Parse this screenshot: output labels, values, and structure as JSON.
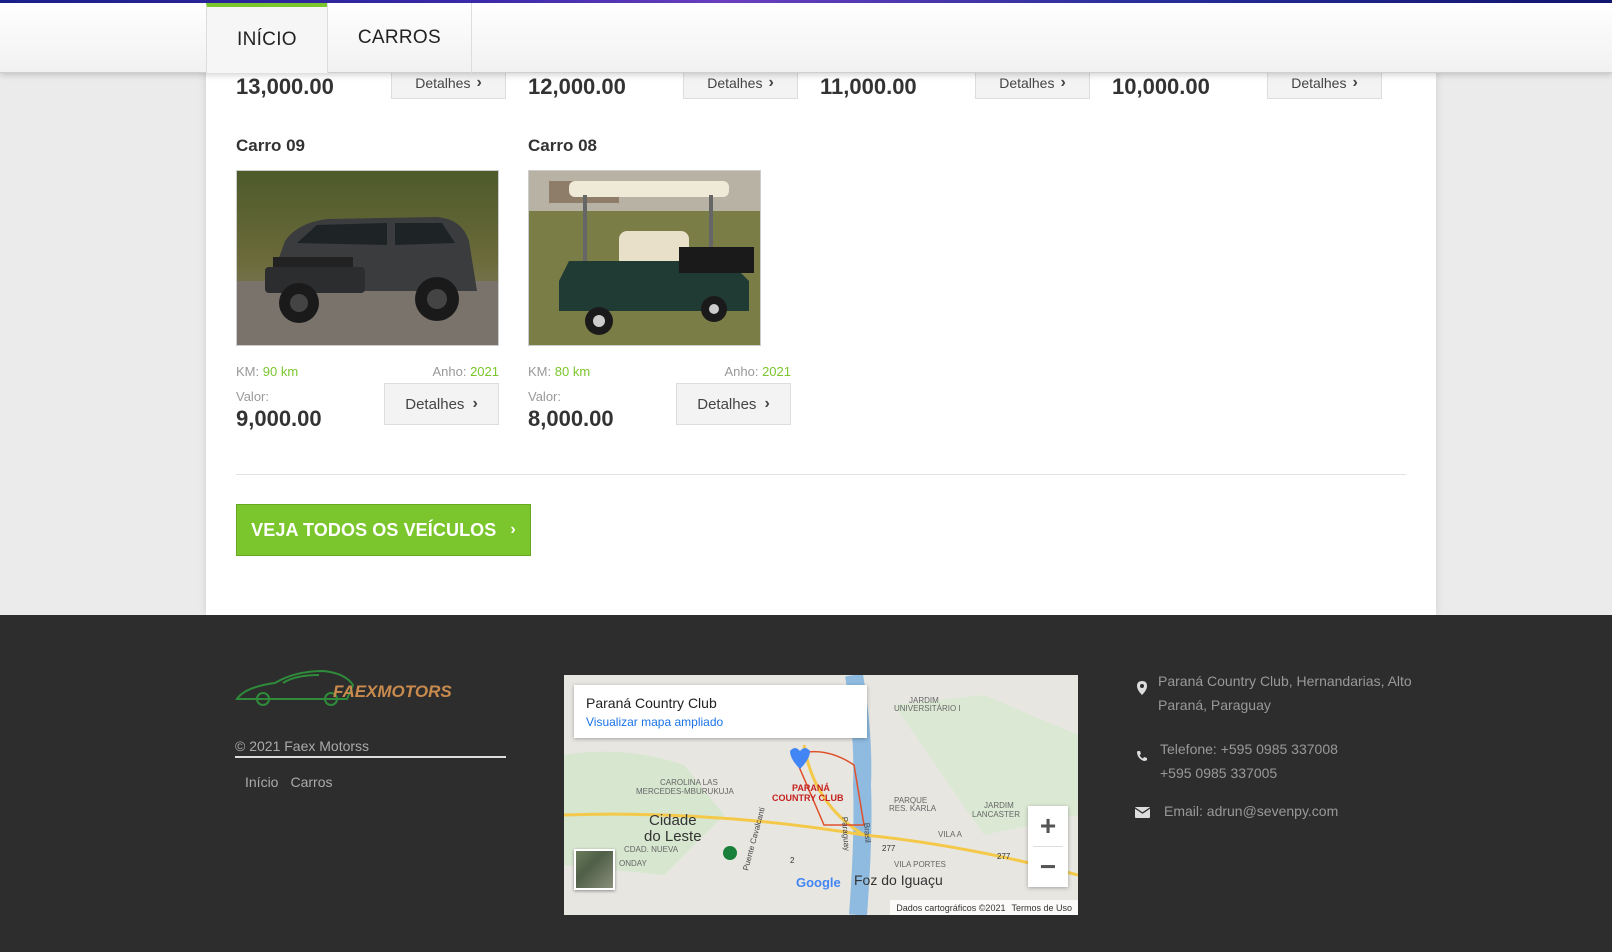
{
  "nav": {
    "tabs": [
      {
        "label": "INÍCIO",
        "active": true
      },
      {
        "label": "CARROS",
        "active": false
      }
    ]
  },
  "listing_top": [
    {
      "price": "13,000.00",
      "details_label": "Detalhes"
    },
    {
      "price": "12,000.00",
      "details_label": "Detalhes"
    },
    {
      "price": "11,000.00",
      "details_label": "Detalhes"
    },
    {
      "price": "10,000.00",
      "details_label": "Detalhes"
    }
  ],
  "cars": [
    {
      "title": "Carro 09",
      "km_label": "KM:",
      "km": "90 km",
      "year_label": "Anho:",
      "year": "2021",
      "valor_label": "Valor:",
      "valor": "9,000.00",
      "details_label": "Detalhes"
    },
    {
      "title": "Carro 08",
      "km_label": "KM:",
      "km": "80 km",
      "year_label": "Anho:",
      "year": "2021",
      "valor_label": "Valor:",
      "valor": "8,000.00",
      "details_label": "Detalhes"
    }
  ],
  "cta": {
    "label": "VEJA TODOS OS VEÍCULOS"
  },
  "footer": {
    "logo_text": "FAEXMOTORS",
    "copyright": "©  2021   Faex Motorss",
    "links": [
      "Início",
      "Carros"
    ],
    "map": {
      "place": "Paraná Country Club",
      "link": "Visualizar mapa ampliado",
      "labels": {
        "cidade": "Cidade",
        "leste": "do Leste",
        "foz": "Foz do Iguaçu",
        "parana": "PARANÁ",
        "country": "COUNTRY CLUB",
        "carolina": "CAROLINA LAS",
        "mercedes": "MERCEDES-MBURUKUJA",
        "jardim_u": "JARDIM",
        "jardim_u2": "UNIVERSITÁRIO I",
        "parque": "PARQUE",
        "karla": "RES. KARLA",
        "jardim_l": "JARDIM",
        "lancaster": "LANCASTER",
        "vila_a": "VILA A",
        "vila_portes": "VILA PORTES",
        "cdad": "CDAD. NUEVA",
        "onday": "ONDAY",
        "puente": "Puente Cavalcanti",
        "paraguay": "Paraguay",
        "brasil": "Brasil",
        "r277a": "277",
        "r277b": "277",
        "r2": "2"
      },
      "google": "Google",
      "attribution": "Dados cartográficos ©2021",
      "terms": "Termos de Uso"
    },
    "contact": {
      "address_line1": "Paraná Country Club, Hernandarias, Alto",
      "address_line2": "Paraná, Paraguay",
      "phone_line1": "Telefone: +595 0985 337008",
      "phone_line2": "+595 0985 337005",
      "email": "Email: adrun@sevenpy.com"
    }
  },
  "colors": {
    "accent": "#7bc62d",
    "footer_bg": "#2d2d2d",
    "map_link": "#1a73e8"
  }
}
